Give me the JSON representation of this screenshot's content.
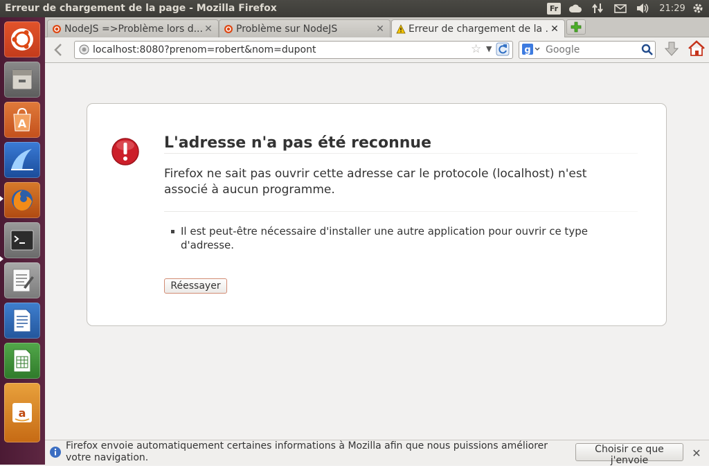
{
  "window": {
    "title": "Erreur de chargement de la page - Mozilla Firefox"
  },
  "panel": {
    "keyboard_layout": "Fr",
    "clock": "21:29"
  },
  "launcher": {
    "items": [
      {
        "name": "ubuntu-dash-icon"
      },
      {
        "name": "files-icon"
      },
      {
        "name": "software-center-icon"
      },
      {
        "name": "wireshark-icon"
      },
      {
        "name": "firefox-icon"
      },
      {
        "name": "terminal-icon"
      },
      {
        "name": "text-editor-icon"
      },
      {
        "name": "libreoffice-writer-icon"
      },
      {
        "name": "libreoffice-calc-icon"
      },
      {
        "name": "amazon-icon"
      }
    ]
  },
  "tabs": [
    {
      "label": "NodeJS =>Problème lors d...",
      "icon": "ubuntu-fr-icon"
    },
    {
      "label": "Problème sur NodeJS",
      "icon": "ubuntu-fr-icon"
    },
    {
      "label": "Erreur de chargement de la ...",
      "icon": "warning-icon"
    }
  ],
  "navbar": {
    "url": "localhost:8080?prenom=robert&nom=dupont",
    "search_placeholder": "Google"
  },
  "error": {
    "title": "L'adresse n'a pas été reconnue",
    "description": "Firefox ne sait pas ouvrir cette adresse car le protocole (localhost) n'est associé à aucun programme.",
    "bullets": [
      "Il est peut-être nécessaire d'installer une autre application pour ouvrir ce type d'adresse."
    ],
    "retry_label": "Réessayer"
  },
  "notification": {
    "text": "Firefox envoie automatiquement certaines informations à Mozilla afin que nous puissions améliorer votre navigation.",
    "button_label": "Choisir ce que j'envoie"
  },
  "colors": {
    "launcher_bg": "#5e2742",
    "panel_bg": "#3c3b37",
    "error_icon": "#cc1f2a",
    "retry_border": "#d28b73"
  }
}
